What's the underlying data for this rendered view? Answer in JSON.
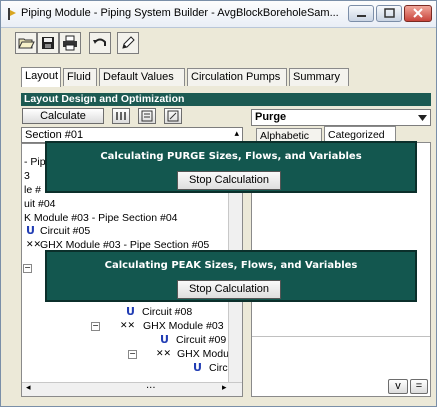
{
  "window": {
    "title": "Piping Module - Piping System Builder - AvgBlockBoreholeSam...",
    "controls": {
      "minimize": "▭",
      "maximize": "▢",
      "close": "✕"
    }
  },
  "toolbar": {
    "buttons": [
      {
        "name": "open-folder-icon"
      },
      {
        "name": "save-icon"
      },
      {
        "name": "print-icon"
      },
      {
        "name": "undo-icon"
      },
      {
        "name": "edit-icon"
      }
    ]
  },
  "tabs": [
    {
      "label": "Layout",
      "active": true
    },
    {
      "label": "Fluid",
      "active": false
    },
    {
      "label": "Default Values",
      "active": false
    },
    {
      "label": "Circulation Pumps",
      "active": false
    },
    {
      "label": "Summary",
      "active": false
    }
  ],
  "layout_panel": {
    "header": "Layout Design and Optimization",
    "calculate_label": "Calculate",
    "section_selected": "Section #01",
    "mode_selected": "Purge",
    "subtabs": [
      {
        "label": "Alphabetic"
      },
      {
        "label": "Categorized"
      }
    ],
    "panel_buttons": {
      "v": "v",
      "eq": "="
    }
  },
  "tree": {
    "items": [
      {
        "text": "- Pip",
        "kind": "text"
      },
      {
        "text": "3",
        "kind": "text"
      },
      {
        "text": "le #",
        "kind": "text"
      },
      {
        "text": "uit #04",
        "kind": "text"
      },
      {
        "text": "K Module #03 - Pipe Section #04",
        "kind": "text"
      },
      {
        "text": "Circuit #05",
        "kind": "circuit"
      },
      {
        "text": "GHX Module #03 - Pipe Section #05",
        "kind": "ghx"
      },
      {
        "text": "Circuit #08",
        "kind": "circuit"
      },
      {
        "text": "GHX Module #03",
        "kind": "ghx"
      },
      {
        "text": "Circuit #09",
        "kind": "circuit"
      },
      {
        "text": "GHX Modu",
        "kind": "ghx"
      },
      {
        "text": "Circ",
        "kind": "circuit"
      }
    ],
    "scroll_left": "◂",
    "scroll_right": "▸",
    "scroll_thumb": "...",
    "scroll_up": "▴"
  },
  "dialogs": {
    "purge": {
      "message": "Calculating PURGE Sizes, Flows, and Variables",
      "button": "Stop Calculation"
    },
    "peak": {
      "message": "Calculating PEAK Sizes, Flows, and Variables",
      "button": "Stop Calculation"
    }
  },
  "colors": {
    "dialog_bg": "#13574f",
    "header_bg": "#1c5a52",
    "circuit_icon": "#1f3bb3"
  }
}
